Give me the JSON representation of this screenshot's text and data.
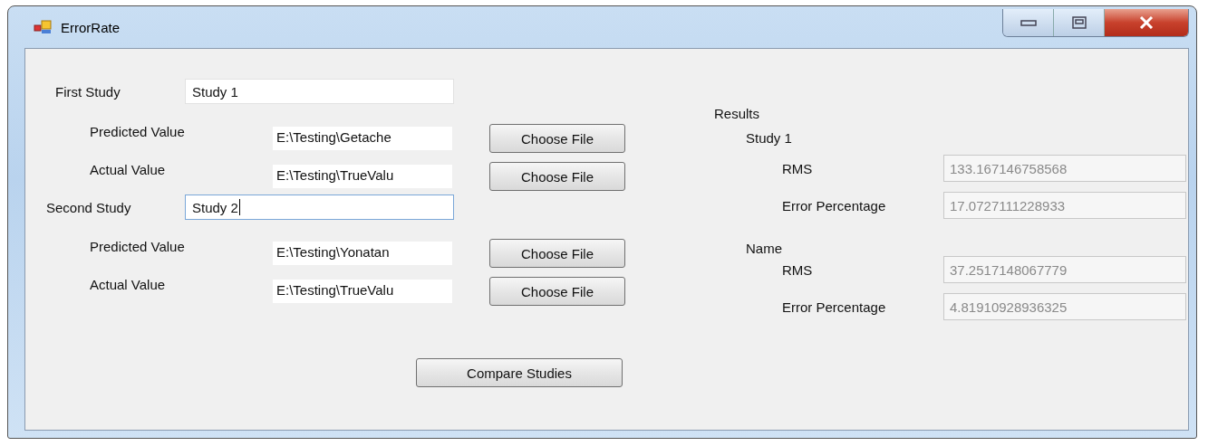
{
  "window": {
    "title": "ErrorRate"
  },
  "studies": [
    {
      "label": "First Study",
      "name": "Study 1",
      "focused": false,
      "files": [
        {
          "label": "Predicted Value",
          "value": "E:\\Testing\\Getache",
          "button": "Choose File"
        },
        {
          "label": "Actual Value",
          "value": "E:\\Testing\\TrueValu",
          "button": "Choose File"
        }
      ]
    },
    {
      "label": "Second Study",
      "name": "Study 2",
      "focused": true,
      "files": [
        {
          "label": "Predicted Value",
          "value": "E:\\Testing\\Yonatan",
          "button": "Choose File"
        },
        {
          "label": "Actual Value",
          "value": "E:\\Testing\\TrueValu",
          "button": "Choose File"
        }
      ]
    }
  ],
  "compare_button": "Compare Studies",
  "results": {
    "title": "Results",
    "groups": [
      {
        "heading": "Study 1",
        "metrics": [
          {
            "label": "RMS",
            "value": "133.167146758568",
            "disabled": true
          },
          {
            "label": "Error Percentage",
            "value": "17.0727111228933",
            "disabled": true
          }
        ]
      },
      {
        "heading": "Name",
        "metrics": [
          {
            "label": "RMS",
            "value": "37.2517148067779",
            "disabled": true
          },
          {
            "label": "Error Percentage",
            "value": "4.81910928936325",
            "disabled": true
          }
        ]
      }
    ]
  }
}
